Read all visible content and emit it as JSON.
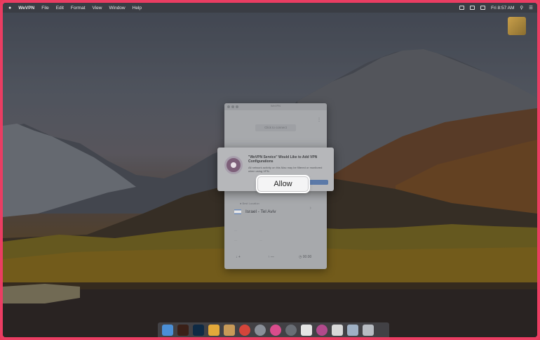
{
  "menubar": {
    "app_name": "WeVPN",
    "items": [
      "File",
      "Edit",
      "Format",
      "View",
      "Window",
      "Help"
    ],
    "clock": "Fri 8:57 AM"
  },
  "vpn_window": {
    "title": "WeVPN",
    "connect_label": "Click to connect",
    "best_location_label": "Best Location",
    "location": "Israel - Tel Aviv",
    "add_label": "+",
    "time_value": "00:00"
  },
  "dialog": {
    "title": "\"WeVPN Service\" Would Like to Add VPN Configurations",
    "body": "All network activity on this Mac may be filtered or monitored when using VPN.",
    "allow_label": "Allow"
  },
  "colors": {
    "frame_border": "#ea3d62",
    "dialog_button_accent": "#5b79a8"
  },
  "dock": {
    "icons": [
      "finder-icon",
      "illustrator-icon",
      "photoshop-icon",
      "sketch-icon",
      "utility-icon",
      "chrome-icon",
      "launchpad-icon",
      "itunes-icon",
      "system-preferences-icon",
      "calendar-icon",
      "wevpn-icon",
      "notes-icon",
      "preview-icon",
      "trash-icon"
    ]
  }
}
